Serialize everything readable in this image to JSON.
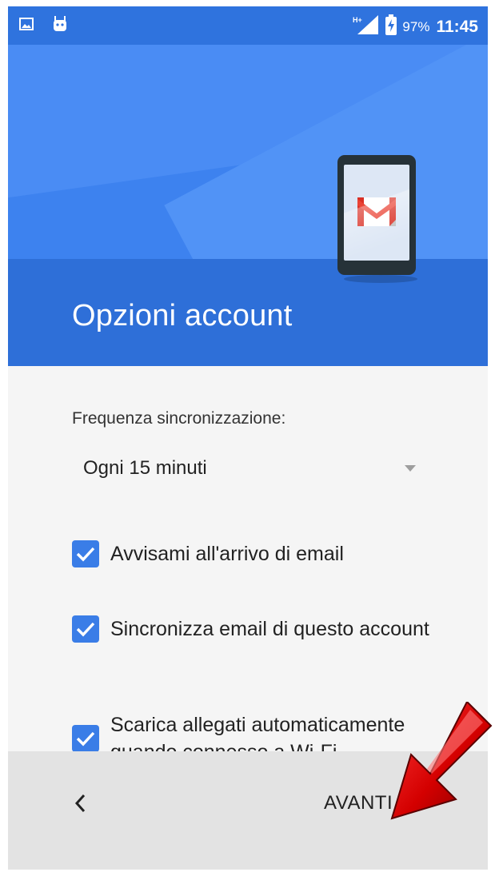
{
  "status_bar": {
    "signal_label": "H+",
    "battery_percent": "97%",
    "time": "11:45"
  },
  "header": {
    "title": "Opzioni account"
  },
  "sync": {
    "frequency_label": "Frequenza sincronizzazione:",
    "frequency_value": "Ogni 15 minuti"
  },
  "options": [
    {
      "label": "Avvisami all'arrivo di email",
      "checked": true
    },
    {
      "label": "Sincronizza email di questo account",
      "checked": true
    },
    {
      "label": "Scarica allegati automaticamente quando connesso a Wi-Fi",
      "checked": true
    }
  ],
  "nav": {
    "next_label": "AVANTI"
  },
  "colors": {
    "accent": "#3a7de7",
    "header": "#3d82ef",
    "arrow_annotation": "#d00000"
  }
}
